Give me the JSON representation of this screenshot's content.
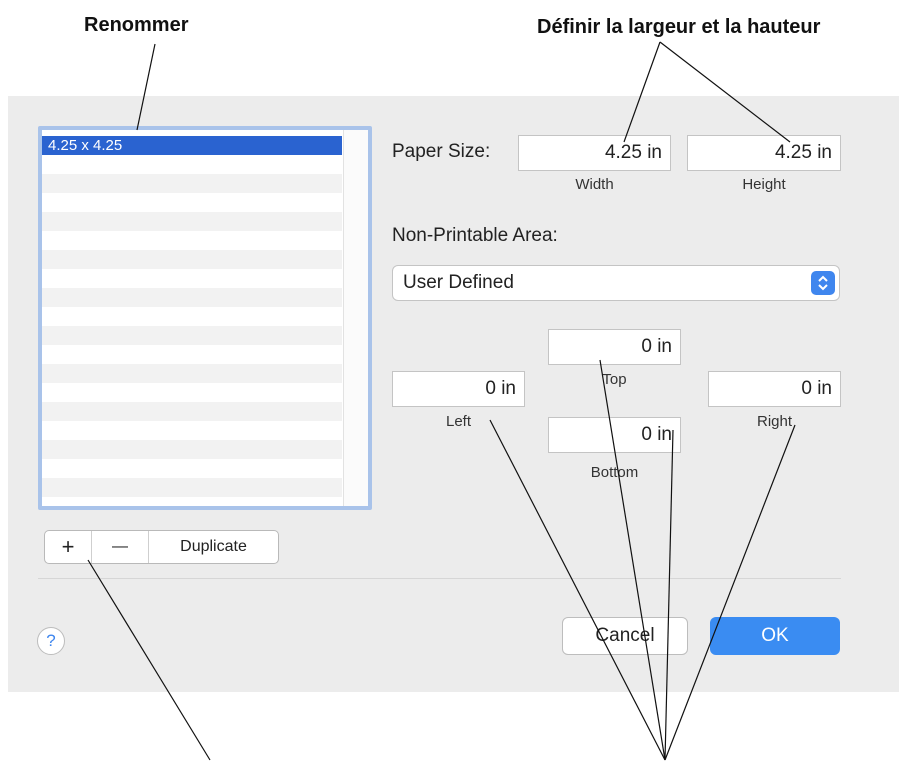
{
  "callouts": {
    "rename": "Renommer",
    "set_size": "Définir la largeur et la hauteur"
  },
  "list": {
    "items": [
      "4.25 x 4.25"
    ]
  },
  "paper_size": {
    "label": "Paper Size:",
    "width_value": "4.25 in",
    "width_caption": "Width",
    "height_value": "4.25 in",
    "height_caption": "Height"
  },
  "non_printable": {
    "label": "Non-Printable Area:",
    "selected": "User Defined",
    "top_value": "0 in",
    "top_caption": "Top",
    "left_value": "0 in",
    "left_caption": "Left",
    "right_value": "0 in",
    "right_caption": "Right",
    "bottom_value": "0 in",
    "bottom_caption": "Bottom"
  },
  "list_controls": {
    "add": "+",
    "remove": "—",
    "duplicate": "Duplicate"
  },
  "footer": {
    "help": "?",
    "cancel": "Cancel",
    "ok": "OK"
  },
  "colors": {
    "selection": "#2a63d0",
    "ok_button": "#3a8cf2",
    "dialog_bg": "#ececec"
  }
}
